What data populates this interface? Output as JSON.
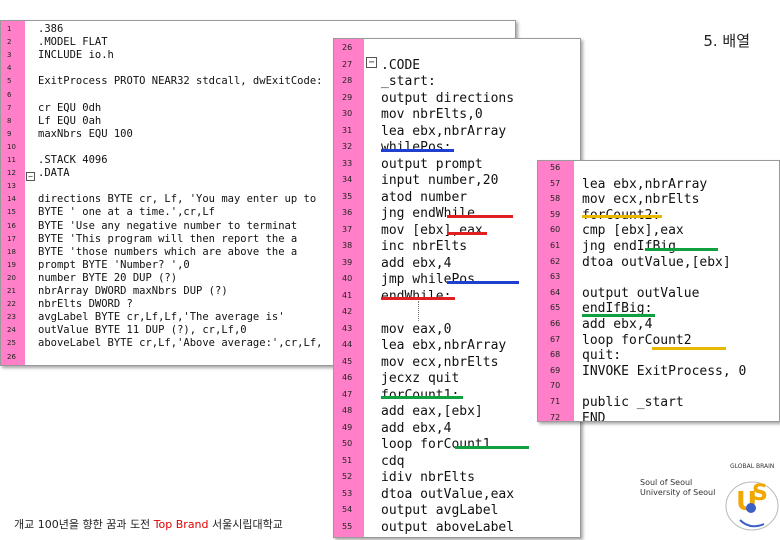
{
  "slide": {
    "title": "5. 배열"
  },
  "panel1": {
    "lines": [
      {
        "n": "1",
        "t": ".386"
      },
      {
        "n": "2",
        "t": ".MODEL FLAT"
      },
      {
        "n": "3",
        "t": "INCLUDE io.h"
      },
      {
        "n": "4",
        "t": ""
      },
      {
        "n": "5",
        "t": "ExitProcess PROTO NEAR32 stdcall, dwExitCode:"
      },
      {
        "n": "6",
        "t": ""
      },
      {
        "n": "7",
        "t": "cr EQU 0dh"
      },
      {
        "n": "8",
        "t": "Lf EQU 0ah"
      },
      {
        "n": "9",
        "t": "maxNbrs EQU 100"
      },
      {
        "n": "10",
        "t": ""
      },
      {
        "n": "11",
        "t": ".STACK 4096"
      },
      {
        "n": "12",
        "t": ".DATA"
      },
      {
        "n": "13",
        "t": ""
      },
      {
        "n": "14",
        "t": "directions BYTE cr, Lf, 'You may enter up to "
      },
      {
        "n": "15",
        "t": "     BYTE ' one at a time.',cr,Lf"
      },
      {
        "n": "16",
        "t": "     BYTE 'Use any negative number to terminat"
      },
      {
        "n": "17",
        "t": "     BYTE 'This program will then report the a"
      },
      {
        "n": "18",
        "t": "     BYTE 'those numbers which are above the a"
      },
      {
        "n": "19",
        "t": "prompt BYTE 'Number? ',0"
      },
      {
        "n": "20",
        "t": "number BYTE 20 DUP (?)"
      },
      {
        "n": "21",
        "t": "nbrArray DWORD maxNbrs DUP (?)"
      },
      {
        "n": "22",
        "t": "nbrElts DWORD ?"
      },
      {
        "n": "23",
        "t": "avgLabel BYTE cr,Lf,Lf,'The average is'"
      },
      {
        "n": "24",
        "t": "outValue BYTE 11 DUP (?), cr,Lf,0"
      },
      {
        "n": "25",
        "t": "aboveLabel BYTE cr,Lf,'Above average:',cr,Lf,"
      },
      {
        "n": "26",
        "t": ""
      }
    ]
  },
  "panel2": {
    "lines": [
      {
        "n": "26",
        "t": ""
      },
      {
        "n": "27",
        "t": ".CODE"
      },
      {
        "n": "28",
        "t": "_start:"
      },
      {
        "n": "29",
        "t": "    output directions"
      },
      {
        "n": "30",
        "t": "    mov nbrElts,0"
      },
      {
        "n": "31",
        "t": "    lea ebx,nbrArray"
      },
      {
        "n": "32",
        "t": "whilePos:"
      },
      {
        "n": "33",
        "t": "    output prompt"
      },
      {
        "n": "34",
        "t": "    input number,20"
      },
      {
        "n": "35",
        "t": "    atod number"
      },
      {
        "n": "36",
        "t": "    jng endWhile"
      },
      {
        "n": "37",
        "t": "    mov [ebx],eax"
      },
      {
        "n": "38",
        "t": "    inc nbrElts"
      },
      {
        "n": "39",
        "t": "    add ebx,4"
      },
      {
        "n": "40",
        "t": "    jmp whilePos"
      },
      {
        "n": "41",
        "t": "endWhile:"
      },
      {
        "n": "42",
        "t": ""
      },
      {
        "n": "43",
        "t": "    mov eax,0"
      },
      {
        "n": "44",
        "t": "    lea ebx,nbrArray"
      },
      {
        "n": "45",
        "t": "    mov ecx,nbrElts"
      },
      {
        "n": "46",
        "t": "    jecxz quit"
      },
      {
        "n": "47",
        "t": "forCount1:"
      },
      {
        "n": "48",
        "t": "    add eax,[ebx]"
      },
      {
        "n": "49",
        "t": "    add ebx,4"
      },
      {
        "n": "50",
        "t": "    loop forCount1"
      },
      {
        "n": "51",
        "t": "    cdq"
      },
      {
        "n": "52",
        "t": "    idiv nbrElts"
      },
      {
        "n": "53",
        "t": "    dtoa outValue,eax"
      },
      {
        "n": "54",
        "t": "    output avgLabel"
      },
      {
        "n": "55",
        "t": "    output aboveLabel"
      }
    ]
  },
  "panel3": {
    "lines": [
      {
        "n": "56",
        "t": ""
      },
      {
        "n": "57",
        "t": "lea ebx,nbrArray"
      },
      {
        "n": "58",
        "t": "mov ecx,nbrElts"
      },
      {
        "n": "59",
        "t": "forCount2:"
      },
      {
        "n": "60",
        "t": "    cmp [ebx],eax"
      },
      {
        "n": "61",
        "t": "    jng endIfBig"
      },
      {
        "n": "62",
        "t": "    dtoa outValue,[ebx]"
      },
      {
        "n": "63",
        "t": ""
      },
      {
        "n": "64",
        "t": "    output outValue"
      },
      {
        "n": "65",
        "t": "endIfBig:"
      },
      {
        "n": "66",
        "t": "    add ebx,4"
      },
      {
        "n": "67",
        "t": "    loop forCount2"
      },
      {
        "n": "68",
        "t": "quit:"
      },
      {
        "n": "69",
        "t": "    INVOKE ExitProcess, 0"
      },
      {
        "n": "70",
        "t": ""
      },
      {
        "n": "71",
        "t": "public _start"
      },
      {
        "n": "72",
        "t": "END"
      }
    ]
  },
  "footer": {
    "text": "개교 100년을 향한 꿈과 도전 ",
    "brand": "Top Brand",
    "university": " 서울시립대학교"
  },
  "logo": {
    "line1": "Soul of Seoul",
    "line2": "University of Seoul",
    "tagline": "GLOBAL BRAIN"
  },
  "colors": {
    "gutter": "#ff80c8",
    "underline_blue": "#1f3fd0",
    "underline_red": "#e02020",
    "underline_green": "#10a040",
    "underline_yellow": "#e8b800"
  }
}
